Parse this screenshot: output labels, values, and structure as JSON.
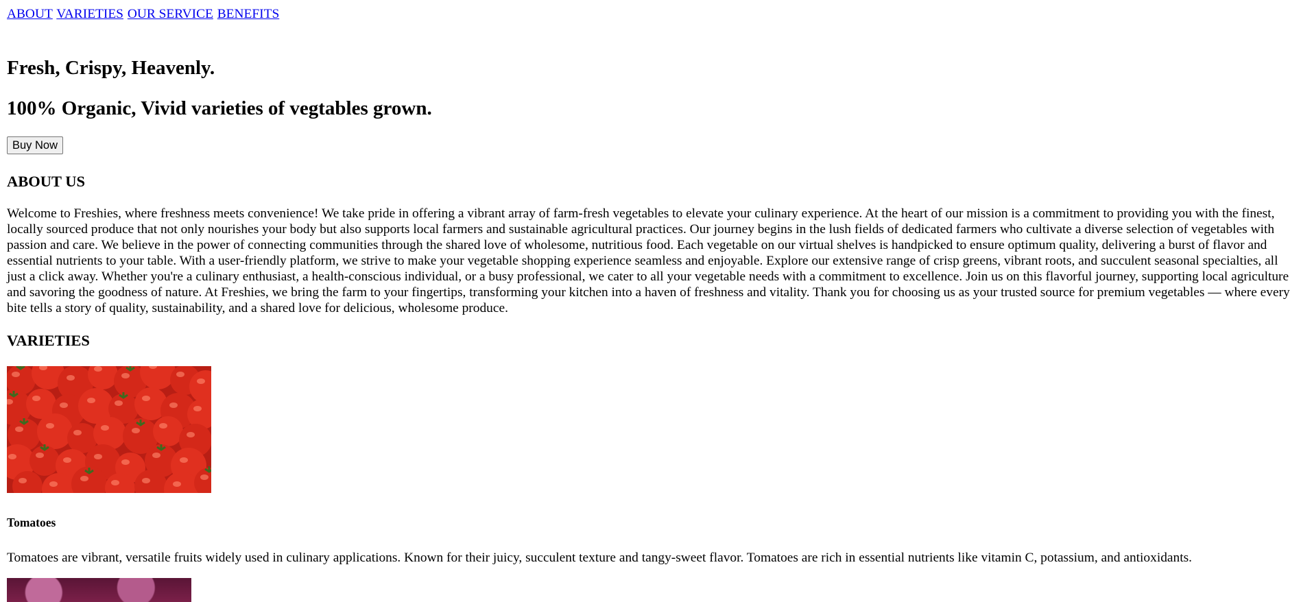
{
  "nav": {
    "items": [
      "ABOUT",
      "VARIETIES",
      "OUR SERVICE",
      "BENEFITS"
    ]
  },
  "hero": {
    "title": "Fresh, Crispy, Heavenly.",
    "subtitle": "100% Organic, Vivid varieties of vegtables grown.",
    "button_label": "Buy Now"
  },
  "about": {
    "heading": "ABOUT US",
    "text": "Welcome to Freshies, where freshness meets convenience! We take pride in offering a vibrant array of farm-fresh vegetables to elevate your culinary experience. At the heart of our mission is a commitment to providing you with the finest, locally sourced produce that not only nourishes your body but also supports local farmers and sustainable agricultural practices. Our journey begins in the lush fields of dedicated farmers who cultivate a diverse selection of vegetables with passion and care. We believe in the power of connecting communities through the shared love of wholesome, nutritious food. Each vegetable on our virtual shelves is handpicked to ensure optimum quality, delivering a burst of flavor and essential nutrients to your table. With a user-friendly platform, we strive to make your vegetable shopping experience seamless and enjoyable. Explore our extensive range of crisp greens, vibrant roots, and succulent seasonal specialties, all just a click away. Whether you're a culinary enthusiast, a health-conscious individual, or a busy professional, we cater to all your vegetable needs with a commitment to excellence. Join us on this flavorful journey, supporting local agriculture and savoring the goodness of nature. At Freshies, we bring the farm to your fingertips, transforming your kitchen into a haven of freshness and vitality. Thank you for choosing us as your trusted source for premium vegetables — where every bite tells a story of quality, sustainability, and a shared love for delicious, wholesome produce."
  },
  "varieties": {
    "heading": "VARIETIES",
    "items": [
      {
        "name": "Tomatoes",
        "description": "Tomatoes are vibrant, versatile fruits widely used in culinary applications. Known for their juicy, succulent texture and tangy-sweet flavor. Tomatoes are rich in essential nutrients like vitamin C, potassium, and antioxidants.",
        "image": "tomatoes-photo"
      },
      {
        "image": "onions-photo"
      }
    ]
  },
  "colors": {
    "link": "#0000ee",
    "text": "#000000",
    "background": "#ffffff",
    "tomato_red": "#c8231a"
  }
}
